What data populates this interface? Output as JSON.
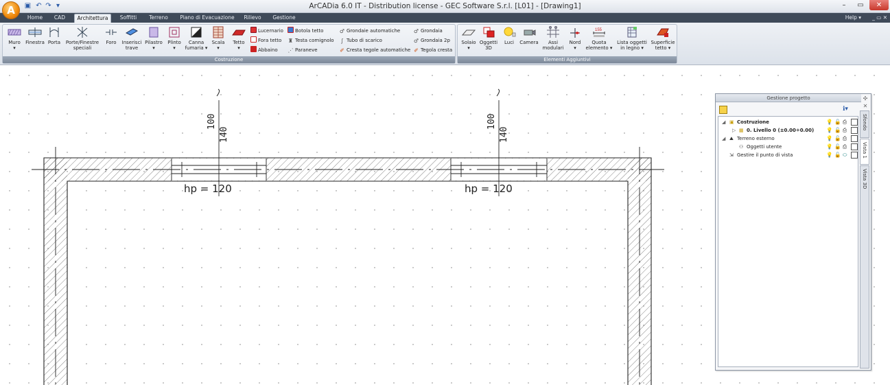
{
  "app": {
    "logo_letter": "A",
    "title": "ArCADia 6.0 IT - Distribution license - GEC Software S.r.l. [L01] - [Drawing1]"
  },
  "window_controls": {
    "minimize": "–",
    "restore": "▭",
    "close": "✕"
  },
  "tabs": [
    {
      "label": "Home"
    },
    {
      "label": "CAD"
    },
    {
      "label": "Architettura"
    },
    {
      "label": "Soffitti"
    },
    {
      "label": "Terreno"
    },
    {
      "label": "Piano di Evacuazione"
    },
    {
      "label": "Rilievo"
    },
    {
      "label": "Gestione"
    }
  ],
  "help": {
    "label": "Help ▾",
    "controls": "_ ▭ ✕"
  },
  "ribbon": {
    "groups": [
      {
        "label": "Costruzione"
      },
      {
        "label": "Elementi Aggiuntivi"
      }
    ],
    "costruzione_big": [
      {
        "label": "Muro",
        "sub": "▾"
      },
      {
        "label": "Finestra",
        "sub": ""
      },
      {
        "label": "Porta",
        "sub": ""
      },
      {
        "label": "Porte/Finestre",
        "sub": "speciali"
      },
      {
        "label": "Foro",
        "sub": ""
      },
      {
        "label": "Inserisci",
        "sub": "trave"
      },
      {
        "label": "Pilastro",
        "sub": "▾"
      },
      {
        "label": "Plinto",
        "sub": "▾"
      },
      {
        "label": "Canna",
        "sub": "fumaria ▾"
      },
      {
        "label": "Scala",
        "sub": "▾"
      },
      {
        "label": "Tetto",
        "sub": "▾"
      }
    ],
    "costruzione_small": [
      {
        "label": "Lucernario"
      },
      {
        "label": "Fora tetto"
      },
      {
        "label": "Abbaino"
      },
      {
        "label": "Botola tetto"
      },
      {
        "label": "Testa comignolo"
      },
      {
        "label": "Paraneve"
      },
      {
        "label": "Grondaie automatiche"
      },
      {
        "label": "Tubo di scarico"
      },
      {
        "label": "Cresta tegole automatiche"
      },
      {
        "label": "Grondaia"
      },
      {
        "label": "Grondaia 2p"
      },
      {
        "label": "Tegola cresta"
      }
    ],
    "aggiuntivi_big": [
      {
        "label": "Solaio",
        "sub": "▾"
      },
      {
        "label": "Oggetti",
        "sub": "3D"
      },
      {
        "label": "Luci",
        "sub": ""
      },
      {
        "label": "Camera",
        "sub": ""
      },
      {
        "label": "Assi",
        "sub": "modulari"
      },
      {
        "label": "Nord",
        "sub": "▾"
      },
      {
        "label": "Quota",
        "sub": "elemento ▾"
      },
      {
        "label": "Lista oggetti",
        "sub": "in legno ▾"
      },
      {
        "label": "Superficie",
        "sub": "tetto ▾"
      }
    ],
    "quota_badge": "155",
    "nord_badge": "N"
  },
  "drawing": {
    "window_left": {
      "sill": "100",
      "height": "140",
      "hp": "hp = 120"
    },
    "window_right": {
      "sill": "100",
      "height": "140",
      "hp": "hp = 120"
    }
  },
  "panel": {
    "title": "Gestione progetto",
    "tree": [
      {
        "label": "Costruzione",
        "bold": true
      },
      {
        "label": "0. Livello 0 (±0.00÷0.00)",
        "bold": true
      },
      {
        "label": "Terreno esterno",
        "bold": false
      },
      {
        "label": "Oggetti utente",
        "bold": false
      },
      {
        "label": "Gestire il punto di vista",
        "bold": false
      }
    ],
    "side_tabs": [
      {
        "label": "Sfondo"
      },
      {
        "label": "Vista 1"
      },
      {
        "label": "Vista 3D"
      }
    ]
  },
  "colors": {
    "accent_orange": "#f08a0c",
    "tab_bar": "#3f4a59",
    "close_red": "#c8382c",
    "wall_outline": "#222222"
  }
}
